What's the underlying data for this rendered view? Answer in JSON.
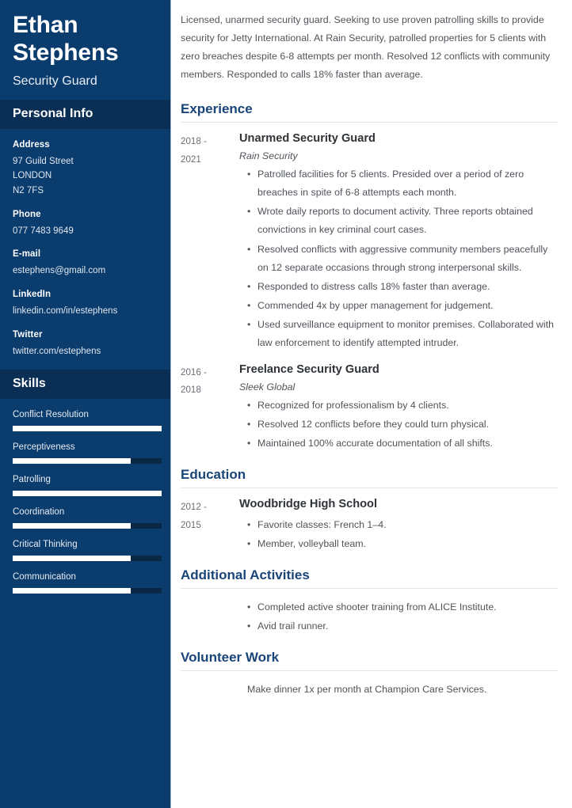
{
  "sidebar": {
    "name": "Ethan Stephens",
    "job_title": "Security Guard",
    "personal_info_heading": "Personal Info",
    "contact": [
      {
        "label": "Address",
        "value": "97 Guild Street\nLONDON\nN2 7FS"
      },
      {
        "label": "Phone",
        "value": "077 7483 9649"
      },
      {
        "label": "E-mail",
        "value": "estephens@gmail.com"
      },
      {
        "label": "LinkedIn",
        "value": "linkedin.com/in/estephens"
      },
      {
        "label": "Twitter",
        "value": "twitter.com/estephens"
      }
    ],
    "skills_heading": "Skills",
    "skills": [
      {
        "name": "Conflict Resolution",
        "level": 100
      },
      {
        "name": "Perceptiveness",
        "level": 79
      },
      {
        "name": "Patrolling",
        "level": 100
      },
      {
        "name": "Coordination",
        "level": 79
      },
      {
        "name": "Critical Thinking",
        "level": 79
      },
      {
        "name": "Communication",
        "level": 79
      }
    ]
  },
  "main": {
    "summary": "Licensed, unarmed security guard. Seeking to use proven patrolling skills to provide security for Jetty International. At Rain Security, patrolled properties for 5 clients with zero breaches despite 6-8 attempts per month. Resolved 12 conflicts with community members. Responded to calls 18% faster than average.",
    "experience": {
      "heading": "Experience",
      "entries": [
        {
          "dates": "2018 -\n2021",
          "title": "Unarmed Security Guard",
          "company": "Rain Security",
          "bullets": [
            "Patrolled facilities for 5 clients. Presided over a period of zero breaches in spite of 6-8 attempts each month.",
            "Wrote daily reports to document activity. Three reports obtained convictions in key criminal court cases.",
            "Resolved conflicts with aggressive community members peacefully on 12 separate occasions through strong interpersonal skills.",
            "Responded to distress calls 18% faster than average.",
            "Commended 4x by upper management for judgement.",
            "Used surveillance equipment to monitor premises. Collaborated with law enforcement to identify attempted intruder."
          ]
        },
        {
          "dates": "2016 -\n2018",
          "title": "Freelance Security Guard",
          "company": "Sleek Global",
          "bullets": [
            "Recognized for professionalism by 4 clients.",
            "Resolved 12 conflicts before they could turn physical.",
            "Maintained 100% accurate documentation of all shifts."
          ]
        }
      ]
    },
    "education": {
      "heading": "Education",
      "entries": [
        {
          "dates": "2012 -\n2015",
          "title": "Woodbridge High School",
          "company": "",
          "bullets": [
            "Favorite classes: French 1–4.",
            "Member, volleyball team."
          ]
        }
      ]
    },
    "additional_activities": {
      "heading": "Additional Activities",
      "bullets": [
        "Completed active shooter training from ALICE Institute.",
        "Avid trail runner."
      ]
    },
    "volunteer_work": {
      "heading": "Volunteer Work",
      "text": "Make dinner 1x per month at Champion Care Services."
    }
  },
  "colors": {
    "sidebar_bg": "#0b3c6e",
    "sidebar_band": "#0a2e54",
    "heading_blue": "#1a4578",
    "skill_fill": "#ffffff",
    "skill_track": "#0a2746"
  }
}
